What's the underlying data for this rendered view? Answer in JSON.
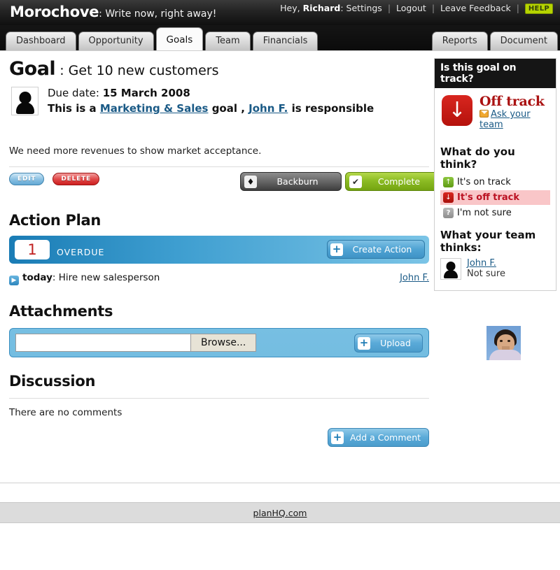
{
  "header": {
    "brand_name": "Morochove",
    "brand_tagline": ": Write now, right away!",
    "greeting": "Hey,",
    "user_name": "Richard",
    "greeting_colon": ":",
    "settings": "Settings",
    "logout": "Logout",
    "feedback": "Leave Feedback",
    "help": "HELP",
    "separator": "|"
  },
  "tabs": {
    "left": [
      {
        "label": "Dashboard",
        "active": false
      },
      {
        "label": "Opportunity",
        "active": false
      },
      {
        "label": "Goals",
        "active": true
      },
      {
        "label": "Team",
        "active": false
      },
      {
        "label": "Financials",
        "active": false
      }
    ],
    "right": [
      {
        "label": "Reports"
      },
      {
        "label": "Document"
      }
    ]
  },
  "goal": {
    "heading_word": "Goal",
    "heading_colon": " : ",
    "title": "Get 10 new customers",
    "due_label": "Due date: ",
    "due_value": "15 March 2008",
    "responsible_prefix": "This is a ",
    "category_link": "Marketing & Sales",
    "responsible_mid": " goal , ",
    "owner_link": "John F.",
    "responsible_suffix": " is responsible",
    "description": "We need more revenues to show market acceptance."
  },
  "actions_toolbar": {
    "edit_label": "EDIT",
    "delete_label": "DELETE",
    "backburn_label": "Backburn",
    "backburn_icon": "flame-icon",
    "complete_label": "Complete",
    "complete_icon": "check-icon"
  },
  "action_plan": {
    "heading": "Action Plan",
    "overdue_count": "1",
    "overdue_label": "OVERDUE",
    "create_label": "Create Action",
    "create_icon": "plus-icon",
    "items": [
      {
        "icon": "play-icon",
        "when": "today",
        "sep": ": ",
        "text": "Hire new salesperson",
        "owner": "John F."
      }
    ]
  },
  "attachments": {
    "heading": "Attachments",
    "file_value": "",
    "file_placeholder": "",
    "browse_label": "Browse...",
    "upload_label": "Upload",
    "upload_icon": "plus-icon"
  },
  "discussion": {
    "heading": "Discussion",
    "empty_text": "There are no comments",
    "add_label": "Add a Comment",
    "add_icon": "plus-icon"
  },
  "sidebar": {
    "title": "Is this goal on track?",
    "status_text": "Off track",
    "status_icon": "down-arrow-icon",
    "ask_label": "Ask your team",
    "ask_icon": "mail-icon",
    "think_heading": "What do you think?",
    "options": [
      {
        "label": "It's on track",
        "icon": "up-arrow-icon",
        "selected": false
      },
      {
        "label": "It's off track",
        "icon": "down-arrow-icon",
        "selected": true
      },
      {
        "label": "I'm not sure",
        "icon": "question-icon",
        "selected": false
      }
    ],
    "team_heading": "What your team thinks:",
    "team": [
      {
        "name": "John F.",
        "vote": "Not sure"
      }
    ]
  },
  "photo": {
    "alt": "profile-photo"
  },
  "footer": {
    "link": "planHQ.com"
  },
  "colors": {
    "accent_blue": "#1a5a86",
    "danger_red": "#aa1111",
    "success_green": "#8cbc24",
    "help_badge": "#b6d400",
    "bar_blue_dark": "#1a7cb5",
    "bar_blue_light": "#7bc4e6",
    "selected_row": "#f9c6c8"
  }
}
